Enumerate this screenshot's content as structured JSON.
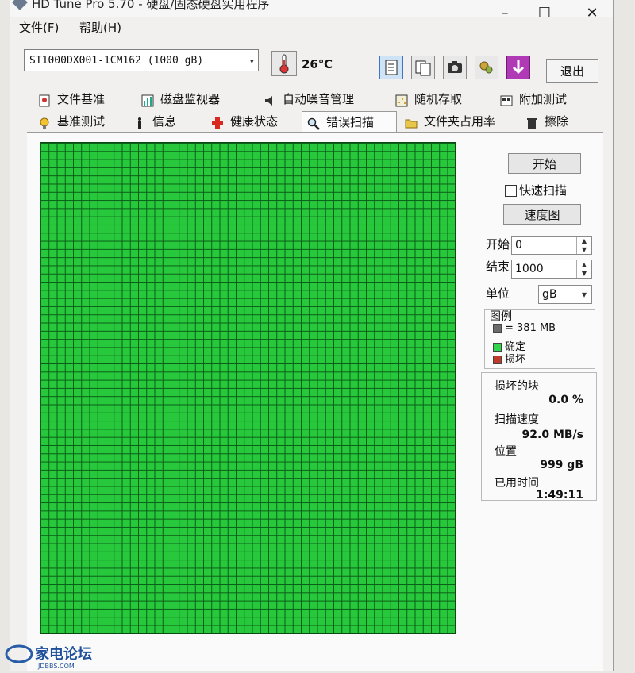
{
  "window": {
    "title": "HD Tune Pro 5.70 - 硬盘/固态硬盘实用程序",
    "min_glyph": "–",
    "max_glyph": "☐",
    "close_glyph": "✕"
  },
  "menu": {
    "file": "文件(F)",
    "help": "帮助(H)"
  },
  "toolbar": {
    "drive": "ST1000DX001-1CM162 (1000 gB)",
    "temperature": "26℃",
    "exit": "退出",
    "icons": [
      "copy-info-icon",
      "copy-screen-icon",
      "camera-icon",
      "options-icon",
      "save-down-icon"
    ],
    "accent_exit_icon": "#b03ab5"
  },
  "tabs_top": [
    "文件基准",
    "磁盘监视器",
    "自动噪音管理",
    "随机存取",
    "附加测试"
  ],
  "tabs_bottom": [
    "基准测试",
    "信息",
    "健康状态",
    "错误扫描",
    "文件夹占用率",
    "擦除"
  ],
  "active_tab": "错误扫描",
  "scan": {
    "start_button": "开始",
    "quick_scan": "快速扫描",
    "quick_scan_checked": false,
    "speed_map_button": "速度图",
    "start_label": "开始",
    "start_value": "0",
    "end_label": "结束",
    "end_value": "1000",
    "unit_label": "单位",
    "unit_value": "gB"
  },
  "legend": {
    "title": "图例",
    "block": "= 381 MB",
    "ok": "确定",
    "bad": "损坏",
    "colors": {
      "block": "#6b6b6b",
      "ok": "#2fd54a",
      "bad": "#c0392b"
    }
  },
  "stats": {
    "damaged_label": "损坏的块",
    "damaged_value": "0.0 %",
    "speed_label": "扫描速度",
    "speed_value": "92.0 MB/s",
    "position_label": "位置",
    "position_value": "999 gB",
    "elapsed_label": "已用时间",
    "elapsed_value": "1:49:11"
  },
  "scan_grid": {
    "color_ok": "#27c83b",
    "state": "all blocks ok"
  },
  "watermark": {
    "text": "家电论坛",
    "sub": "JDBBS.COM"
  }
}
